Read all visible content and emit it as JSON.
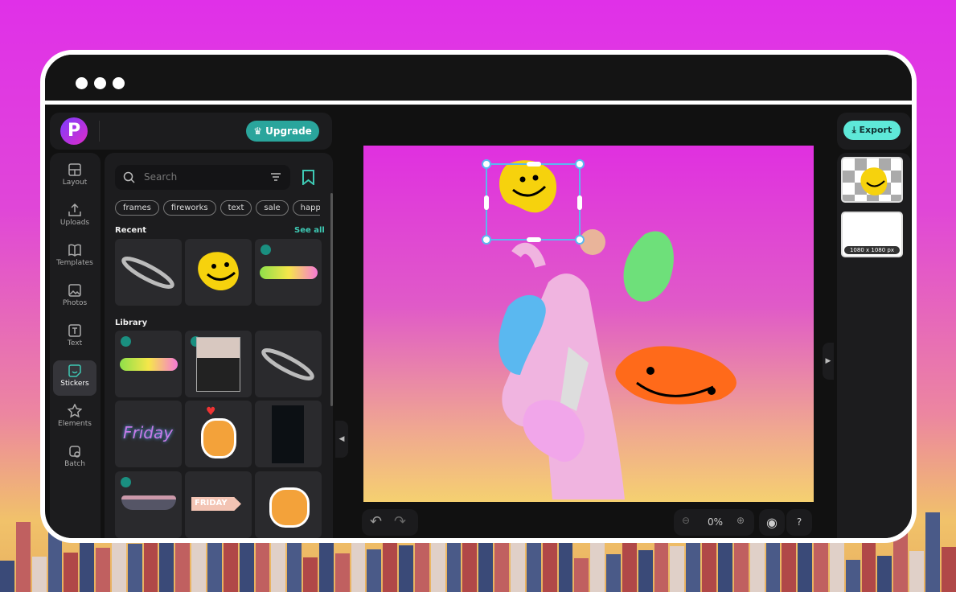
{
  "window": {
    "dots": 3
  },
  "header": {
    "logo": "P",
    "upgrade_label": "Upgrade"
  },
  "sidebar": {
    "items": [
      {
        "label": "Layout",
        "icon": "layout-icon"
      },
      {
        "label": "Uploads",
        "icon": "upload-icon"
      },
      {
        "label": "Templates",
        "icon": "book-icon"
      },
      {
        "label": "Photos",
        "icon": "image-icon"
      },
      {
        "label": "Text",
        "icon": "text-icon"
      },
      {
        "label": "Stickers",
        "icon": "sticker-icon",
        "active": true
      },
      {
        "label": "Elements",
        "icon": "star-icon"
      },
      {
        "label": "Batch",
        "icon": "batch-icon"
      }
    ]
  },
  "stickers": {
    "search_placeholder": "Search",
    "chips": [
      "frames",
      "fireworks",
      "text",
      "sale",
      "happ"
    ],
    "recent_title": "Recent",
    "see_all": "See all",
    "library_title": "Library",
    "friday_text": "Friday",
    "friday_tag": "FRIDAY"
  },
  "canvas": {
    "zoom": "0%"
  },
  "right": {
    "export_label": "Export",
    "page_size": "1080 x 1080 px"
  },
  "colors": {
    "accent": "#2aa59c",
    "export": "#5ee8d8",
    "selection": "#5ab8f0"
  }
}
